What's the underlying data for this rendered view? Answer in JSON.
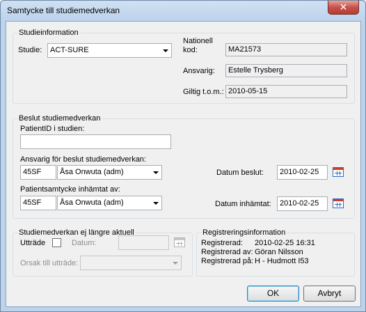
{
  "window": {
    "title": "Samtycke till studiemedverkan",
    "close_glyph": "✕"
  },
  "studieinformation": {
    "legend": "Studieinformation",
    "studie_label": "Studie:",
    "studie_value": "ACT-SURE",
    "nationell_kod_label_1": "Nationell",
    "nationell_kod_label_2": "kod:",
    "nationell_kod_value": "MA21573",
    "ansvarig_label": "Ansvarig:",
    "ansvarig_value": "Estelle Trysberg",
    "giltig_label": "Giltig t.o.m.:",
    "giltig_value": "2010-05-15"
  },
  "beslut": {
    "legend": "Beslut studiemedverkan",
    "patientid_label": "PatientID i studien:",
    "patientid_value": "",
    "ansvarig_beslut_label": "Ansvarig för beslut studiemedverkan:",
    "ansvarig_beslut_code": "45SF",
    "ansvarig_beslut_name": "Åsa Onwuta (adm)",
    "datum_beslut_label": "Datum beslut:",
    "datum_beslut_value": "2010-02-25",
    "patientsamtycke_label": "Patientsamtycke inhämtat av:",
    "patientsamtycke_code": "45SF",
    "patientsamtycke_name": "Åsa Onwuta (adm)",
    "datum_inhamtat_label": "Datum inhämtat:",
    "datum_inhamtat_value": "2010-02-25"
  },
  "ej_aktuell": {
    "legend": "Studiemedverkan ej längre aktuell",
    "uttrade_label": "Utträde",
    "uttrade_checked": false,
    "datum_label": "Datum:",
    "datum_value": "",
    "orsak_label": "Orsak till utträde:",
    "orsak_value": ""
  },
  "registrering": {
    "legend": "Registreringsinformation",
    "registrerad_label": "Registrerad:",
    "registrerad_value": "2010-02-25 16:31",
    "registrerad_av_label": "Registrerad av:",
    "registrerad_av_value": "Göran Nilsson",
    "registrerad_pa_label": "Registrerad på:",
    "registrerad_pa_value": "H - Hudmott I53"
  },
  "buttons": {
    "ok": "OK",
    "cancel": "Avbryt"
  },
  "icons": {
    "close": "close-icon",
    "dropdown": "chevron-down-icon",
    "calendar": "calendar-icon"
  }
}
